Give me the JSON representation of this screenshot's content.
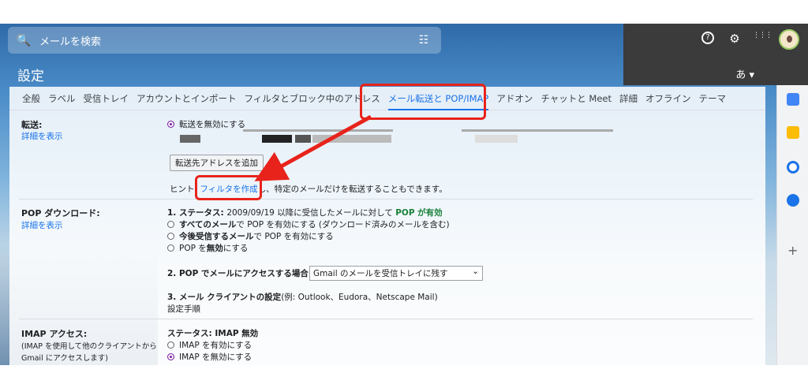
{
  "search": {
    "placeholder": "メールを検索"
  },
  "header": {
    "title": "設定",
    "lang_label": "あ ▾"
  },
  "icons": {
    "search": "🔍",
    "tune": "☷",
    "help": "?",
    "gear": "⚙",
    "apps": "⋮⋮⋮"
  },
  "tabs": [
    "全般",
    "ラベル",
    "受信トレイ",
    "アカウントとインポート",
    "フィルタとブロック中のアドレス",
    "メール転送と POP/IMAP",
    "アドオン",
    "チャットと Meet",
    "詳細",
    "オフライン",
    "テーマ"
  ],
  "forwarding": {
    "label": "転送:",
    "detail": "詳細を表示",
    "disabled_option": "転送を無効にする",
    "add_button": "転送先アドレスを追加",
    "hint_prefix": "ヒント: ",
    "hint_link": "フィルタを作成",
    "hint_suffix": "し、特定のメールだけを転送することもできます。"
  },
  "pop": {
    "label": "POP ダウンロード:",
    "detail": "詳細を表示",
    "status_prefix": "1. ステータス: ",
    "status_text": "2009/09/19 以降に受信したメールに対して ",
    "status_value": "POP が有効",
    "opt1_bold": "すべてのメール",
    "opt1_rest": "で POP を有効にする (ダウンロード済みのメールを含む)",
    "opt2_bold": "今後受信するメール",
    "opt2_rest": "で POP を有効にする",
    "opt3_a": "POP を",
    "opt3_bold": "無効",
    "opt3_b": "にする",
    "access_label": "2. POP でメールにアクセスする場合",
    "access_select": "Gmail のメールを受信トレイに残す",
    "client_label": "3. メール クライアントの設定",
    "client_example": "(例: Outlook、Eudora、Netscape Mail)",
    "client_link": "設定手順"
  },
  "imap": {
    "label": "IMAP アクセス:",
    "sub1": "(IMAP を使用して他のクライアントから",
    "sub2": "Gmail にアクセスします)",
    "status": "ステータス: IMAP 無効",
    "opt_enable": "IMAP を有効にする",
    "opt_disable": "IMAP を無効にする"
  },
  "colors": {
    "annotation": "#e8231b",
    "link": "#1a73e8",
    "pop_enabled": "#188038"
  }
}
